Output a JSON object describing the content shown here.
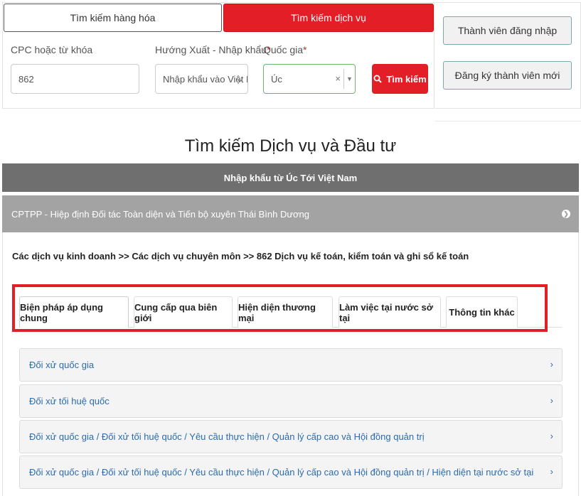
{
  "search": {
    "tab_goods": "Tìm kiếm hàng hóa",
    "tab_services": "Tìm kiếm dịch vụ",
    "cpc_label": "CPC hoặc từ khóa",
    "cpc_value": "862",
    "direction_label": "Hướng Xuất - Nhập khẩu",
    "direction_value": "Nhập khẩu vào Việt I",
    "country_label": "Quốc gia",
    "country_value": "Úc",
    "required_mark": "*",
    "clear_symbol": "×",
    "search_button": "Tìm kiếm"
  },
  "member": {
    "login": "Thành viên đăng nhập",
    "register": "Đăng ký thành viên mới"
  },
  "page": {
    "title": "Tìm kiếm Dịch vụ và Đầu tư",
    "route_bar": "Nhập khẩu từ Úc Tới Việt Nam",
    "agreement": "CPTPP - Hiệp định Đối tác Toàn diện và Tiến bộ xuyên Thái Bình Dương",
    "breadcrumb": "Các dịch vụ kinh doanh >> Các dịch vụ chuyên môn >> 862 Dịch vụ kế toán, kiểm toán và ghi sổ kế toán"
  },
  "tabs": [
    {
      "label": "Biện pháp áp dụng chung"
    },
    {
      "label": "Cung cấp qua biên giới"
    },
    {
      "label": "Hiện diện thương mại"
    },
    {
      "label": "Làm việc tại nước sở tại"
    },
    {
      "label": "Thông tin khác"
    }
  ],
  "accordion": [
    {
      "label": "Đối xử quốc gia"
    },
    {
      "label": "Đối xử tối huệ quốc"
    },
    {
      "label": "Đối xử quốc gia / Đối xử tối huệ quốc / Yêu cầu thực hiện / Quản lý cấp cao và Hội đồng quản trị"
    },
    {
      "label": "Đối xử quốc gia / Đối xử tối huệ quốc / Yêu cầu thực hiện / Quản lý cấp cao và Hội đồng quản trị / Hiện diện tại nước sở tại"
    }
  ],
  "icons": {
    "search": "search-icon",
    "chevron_down": "chevron-down-icon",
    "chevron_right": "chevron-right-icon",
    "circle_arrow": "arrow-circle-right-icon"
  },
  "colors": {
    "accent": "#e41e26",
    "route_bar": "#6f6f6f",
    "agreement_bar": "#a3a3a3",
    "link": "#2a6cae"
  }
}
